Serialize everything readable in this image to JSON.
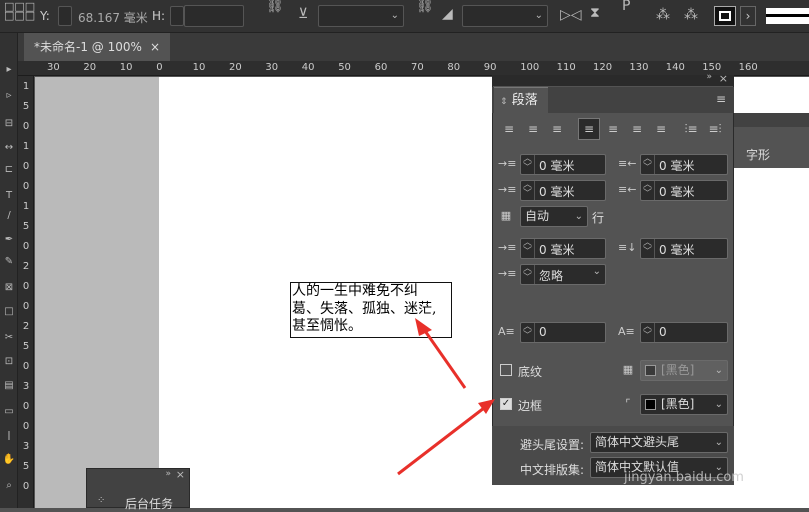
{
  "control_bar": {
    "y_label": "Y:",
    "y_value": "68.167 毫米",
    "h_label": "H:",
    "h_value": ""
  },
  "document": {
    "tab_title": "*未命名-1 @ 100%",
    "close_glyph": "×"
  },
  "ruler": {
    "h_ticks": [
      "30",
      "20",
      "10",
      "0",
      "10",
      "20",
      "30",
      "40",
      "50",
      "60",
      "70",
      "80",
      "90",
      "100",
      "110",
      "120",
      "130",
      "140",
      "150",
      "160"
    ],
    "v_ticks": [
      "1",
      "5",
      "0",
      "1",
      "0",
      "0",
      "1",
      "5",
      "0",
      "2",
      "0",
      "0",
      "2",
      "5",
      "0",
      "3",
      "0",
      "0",
      "3",
      "5",
      "0"
    ]
  },
  "text_frame": {
    "lines": [
      "人的一生中难免不纠",
      "葛、失落、孤独、迷茫,",
      "甚至惆怅。"
    ]
  },
  "paragraph_panel": {
    "tab_label": "段落",
    "left_indent": "0 毫米",
    "right_indent": "0 毫米",
    "first_line_indent": "0 毫米",
    "last_line_indent": "0 毫米",
    "leading_mode": "自动",
    "leading_unit": "行",
    "space_before": "0 毫米",
    "space_after": "0 毫米",
    "drop_cap_mode": "忽略",
    "drop_cap_lines": "0",
    "drop_cap_chars": "0",
    "shading_label": "底纹",
    "shading_color": "[黑色]",
    "border_label": "边框",
    "border_color": "[黑色]",
    "kinsoku_label": "避头尾设置:",
    "kinsoku_value": "简体中文避头尾",
    "mojikumi_label": "中文排版集:",
    "mojikumi_value": "简体中文默认值"
  },
  "char_panel": {
    "tab_label": "字形"
  },
  "bg_panel": {
    "label": "后台任务"
  },
  "watermark": "jingyan.baidu.com",
  "colors": {
    "annotation_arrow": "#e8302a",
    "panel_bg": "#535353",
    "page_bg": "#ffffff"
  }
}
